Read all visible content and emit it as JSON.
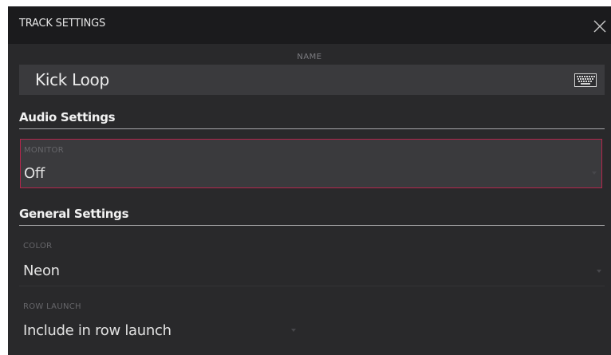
{
  "dialog": {
    "title": "TRACK SETTINGS",
    "close_icon": "close-icon"
  },
  "name": {
    "label": "NAME",
    "value": "Kick Loop",
    "keyboard_icon": "keyboard-icon"
  },
  "audio_settings": {
    "heading": "Audio Settings",
    "monitor": {
      "label": "MONITOR",
      "value": "Off"
    }
  },
  "general_settings": {
    "heading": "General Settings",
    "color": {
      "label": "COLOR",
      "value": "Neon"
    },
    "row_launch": {
      "label": "ROW LAUNCH",
      "value": "Include in row launch"
    }
  },
  "colors": {
    "background": "#29292b",
    "titlebar": "#1b1b1d",
    "field": "#3a3a3d",
    "focus_border": "#b4264c"
  }
}
